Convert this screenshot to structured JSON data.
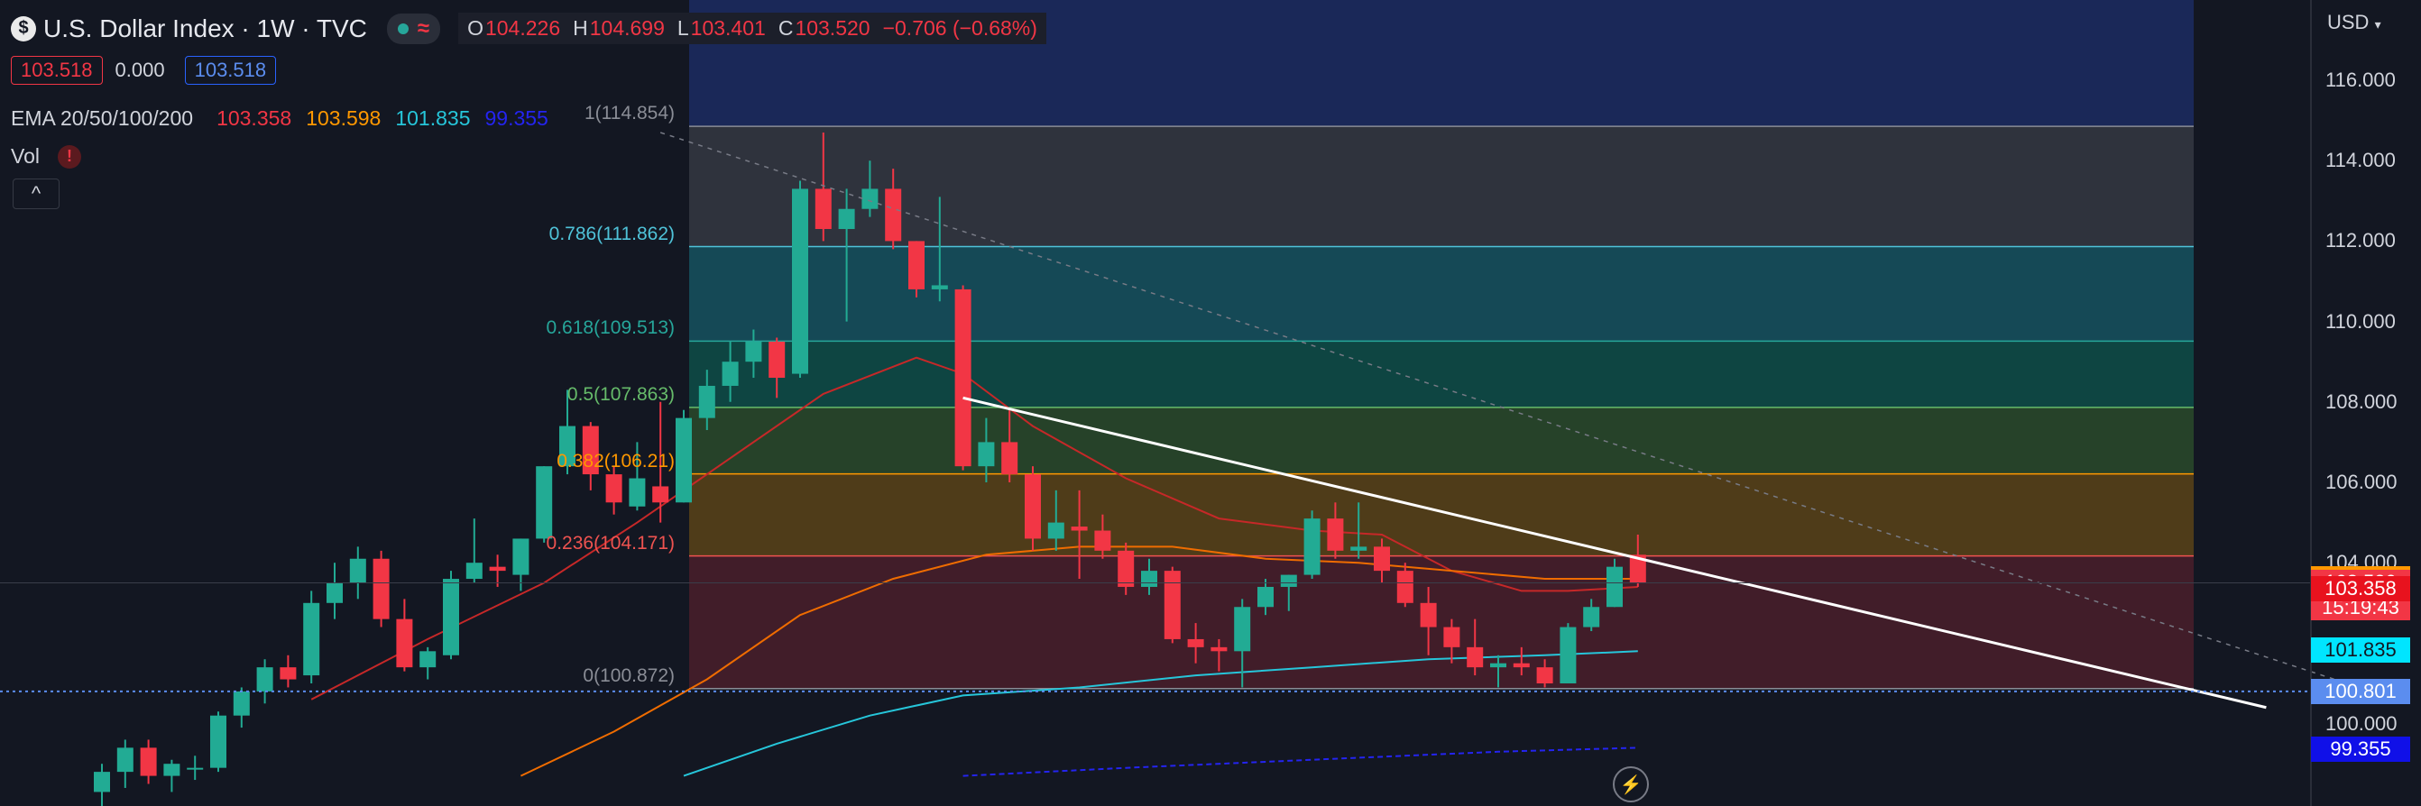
{
  "header": {
    "symbol_icon": "$",
    "title": "U.S. Dollar Index · 1W · TVC",
    "market_status_icon": "market-open-dot-icon",
    "wave_icon": "≈",
    "ohlc": {
      "o_label": "O",
      "o_value": "104.226",
      "h_label": "H",
      "h_value": "104.699",
      "l_label": "L",
      "l_value": "103.401",
      "c_label": "C",
      "c_value": "103.520",
      "change": "−0.706 (−0.68%)"
    }
  },
  "quote": {
    "sell": "103.518",
    "spread": "0.000",
    "buy": "103.518"
  },
  "indicators": {
    "ema_label": "EMA 20/50/100/200",
    "ema_values": [
      {
        "value": "103.358",
        "color": "#f23645"
      },
      {
        "value": "103.598",
        "color": "#ff9800"
      },
      {
        "value": "101.835",
        "color": "#26c6da"
      },
      {
        "value": "99.355",
        "color": "#2424f0"
      }
    ],
    "vol_label": "Vol",
    "vol_warning_icon": "!",
    "collapse_icon": "^"
  },
  "price_axis": {
    "currency": "USD",
    "ticks": [
      "116.000",
      "114.000",
      "112.000",
      "110.000",
      "108.000",
      "106.000",
      "104.000",
      "100.000"
    ],
    "tags": [
      {
        "text": "103.598",
        "bg": "#ff9800"
      },
      {
        "text": "103.520",
        "bg": "#f23645"
      },
      {
        "text": "15:19:43",
        "bg": "#f23645"
      },
      {
        "text": "103.358",
        "bg": "#e8121e"
      },
      {
        "text": "101.835",
        "bg": "#00e5ff"
      },
      {
        "text": "100.801",
        "bg": "#5b8def"
      },
      {
        "text": "99.355",
        "bg": "#1010e8"
      }
    ]
  },
  "fib": {
    "levels": [
      {
        "label": "1(114.854)",
        "color": "#8a8d96"
      },
      {
        "label": "0.786(111.862)",
        "color": "#4fc3d9"
      },
      {
        "label": "0.618(109.513)",
        "color": "#26a69a"
      },
      {
        "label": "0.5(107.863)",
        "color": "#66bb6a"
      },
      {
        "label": "0.382(106.21)",
        "color": "#ff9800"
      },
      {
        "label": "0.236(104.171)",
        "color": "#ef5350"
      },
      {
        "label": "0(100.872)",
        "color": "#8a8d96"
      }
    ]
  },
  "chart_data": {
    "type": "candlestick",
    "title": "U.S. Dollar Index · 1W · TVC",
    "ylabel": "USD",
    "ylim": [
      98.7,
      117.2
    ],
    "grid": false,
    "fib_retracement_values": [
      114.854,
      111.862,
      109.513,
      107.863,
      106.21,
      104.171,
      100.872
    ],
    "trendline": {
      "from": [
        37,
        108.1
      ],
      "to": [
        93,
        100.4
      ]
    },
    "dotted_line": {
      "from": [
        24,
        114.7
      ],
      "to": [
        97,
        100.9
      ]
    },
    "horizontal_price_line": 100.801,
    "candles": [
      {
        "o": 98.3,
        "h": 99.0,
        "l": 97.9,
        "c": 98.8
      },
      {
        "o": 98.8,
        "h": 99.6,
        "l": 98.4,
        "c": 99.4
      },
      {
        "o": 99.4,
        "h": 99.6,
        "l": 98.5,
        "c": 98.7
      },
      {
        "o": 98.7,
        "h": 99.1,
        "l": 98.3,
        "c": 99.0
      },
      {
        "o": 98.9,
        "h": 99.2,
        "l": 98.6,
        "c": 98.9
      },
      {
        "o": 98.9,
        "h": 100.3,
        "l": 98.8,
        "c": 100.2
      },
      {
        "o": 100.2,
        "h": 100.9,
        "l": 99.9,
        "c": 100.8
      },
      {
        "o": 100.8,
        "h": 101.6,
        "l": 100.5,
        "c": 101.4
      },
      {
        "o": 101.4,
        "h": 101.7,
        "l": 100.9,
        "c": 101.1
      },
      {
        "o": 101.2,
        "h": 103.3,
        "l": 101.0,
        "c": 103.0
      },
      {
        "o": 103.0,
        "h": 104.0,
        "l": 102.6,
        "c": 103.5
      },
      {
        "o": 103.5,
        "h": 104.4,
        "l": 103.1,
        "c": 104.1
      },
      {
        "o": 104.1,
        "h": 104.3,
        "l": 102.4,
        "c": 102.6
      },
      {
        "o": 102.6,
        "h": 103.1,
        "l": 101.3,
        "c": 101.4
      },
      {
        "o": 101.4,
        "h": 101.9,
        "l": 101.1,
        "c": 101.8
      },
      {
        "o": 101.7,
        "h": 103.8,
        "l": 101.6,
        "c": 103.6
      },
      {
        "o": 103.6,
        "h": 105.1,
        "l": 103.5,
        "c": 104.0
      },
      {
        "o": 103.9,
        "h": 104.2,
        "l": 103.4,
        "c": 103.8
      },
      {
        "o": 103.7,
        "h": 104.6,
        "l": 103.3,
        "c": 104.6
      },
      {
        "o": 104.6,
        "h": 106.4,
        "l": 104.5,
        "c": 106.4
      },
      {
        "o": 106.4,
        "h": 108.3,
        "l": 106.2,
        "c": 107.4
      },
      {
        "o": 107.4,
        "h": 107.5,
        "l": 105.8,
        "c": 106.2
      },
      {
        "o": 106.2,
        "h": 106.4,
        "l": 105.2,
        "c": 105.5
      },
      {
        "o": 105.4,
        "h": 107.0,
        "l": 105.3,
        "c": 106.1
      },
      {
        "o": 105.9,
        "h": 108.0,
        "l": 105.0,
        "c": 105.5
      },
      {
        "o": 105.5,
        "h": 107.8,
        "l": 105.5,
        "c": 107.6
      },
      {
        "o": 107.6,
        "h": 108.8,
        "l": 107.3,
        "c": 108.4
      },
      {
        "o": 108.4,
        "h": 109.5,
        "l": 108.0,
        "c": 109.0
      },
      {
        "o": 109.0,
        "h": 109.8,
        "l": 108.6,
        "c": 109.5
      },
      {
        "o": 109.5,
        "h": 109.6,
        "l": 108.1,
        "c": 108.6
      },
      {
        "o": 108.7,
        "h": 113.5,
        "l": 108.6,
        "c": 113.3
      },
      {
        "o": 113.3,
        "h": 114.7,
        "l": 112.0,
        "c": 112.3
      },
      {
        "o": 112.3,
        "h": 113.3,
        "l": 110.0,
        "c": 112.8
      },
      {
        "o": 112.8,
        "h": 114.0,
        "l": 112.6,
        "c": 113.3
      },
      {
        "o": 113.3,
        "h": 113.8,
        "l": 111.8,
        "c": 112.0
      },
      {
        "o": 112.0,
        "h": 112.0,
        "l": 110.6,
        "c": 110.8
      },
      {
        "o": 110.8,
        "h": 113.1,
        "l": 110.5,
        "c": 110.9
      },
      {
        "o": 110.8,
        "h": 110.9,
        "l": 106.3,
        "c": 106.4
      },
      {
        "o": 106.4,
        "h": 107.6,
        "l": 106.0,
        "c": 107.0
      },
      {
        "o": 107.0,
        "h": 107.8,
        "l": 106.0,
        "c": 106.2
      },
      {
        "o": 106.2,
        "h": 106.4,
        "l": 104.3,
        "c": 104.6
      },
      {
        "o": 104.6,
        "h": 105.8,
        "l": 104.3,
        "c": 105.0
      },
      {
        "o": 104.9,
        "h": 105.8,
        "l": 103.6,
        "c": 104.8
      },
      {
        "o": 104.8,
        "h": 105.2,
        "l": 104.1,
        "c": 104.3
      },
      {
        "o": 104.3,
        "h": 104.5,
        "l": 103.2,
        "c": 103.4
      },
      {
        "o": 103.4,
        "h": 104.1,
        "l": 103.2,
        "c": 103.8
      },
      {
        "o": 103.8,
        "h": 103.9,
        "l": 102.0,
        "c": 102.1
      },
      {
        "o": 102.1,
        "h": 102.5,
        "l": 101.5,
        "c": 101.9
      },
      {
        "o": 101.9,
        "h": 102.1,
        "l": 101.3,
        "c": 101.8
      },
      {
        "o": 101.8,
        "h": 103.1,
        "l": 100.9,
        "c": 102.9
      },
      {
        "o": 102.9,
        "h": 103.6,
        "l": 102.7,
        "c": 103.4
      },
      {
        "o": 103.4,
        "h": 103.7,
        "l": 102.8,
        "c": 103.7
      },
      {
        "o": 103.7,
        "h": 105.3,
        "l": 103.6,
        "c": 105.1
      },
      {
        "o": 105.1,
        "h": 105.5,
        "l": 104.1,
        "c": 104.3
      },
      {
        "o": 104.3,
        "h": 105.5,
        "l": 104.1,
        "c": 104.4
      },
      {
        "o": 104.4,
        "h": 104.6,
        "l": 103.5,
        "c": 103.8
      },
      {
        "o": 103.8,
        "h": 104.0,
        "l": 102.9,
        "c": 103.0
      },
      {
        "o": 103.0,
        "h": 103.4,
        "l": 101.7,
        "c": 102.4
      },
      {
        "o": 102.4,
        "h": 102.6,
        "l": 101.5,
        "c": 101.9
      },
      {
        "o": 101.9,
        "h": 102.6,
        "l": 101.2,
        "c": 101.4
      },
      {
        "o": 101.4,
        "h": 101.7,
        "l": 100.9,
        "c": 101.5
      },
      {
        "o": 101.5,
        "h": 101.9,
        "l": 101.2,
        "c": 101.4
      },
      {
        "o": 101.4,
        "h": 101.6,
        "l": 100.9,
        "c": 101.0
      },
      {
        "o": 101.0,
        "h": 102.5,
        "l": 101.0,
        "c": 102.4
      },
      {
        "o": 102.4,
        "h": 103.1,
        "l": 102.3,
        "c": 102.9
      },
      {
        "o": 102.9,
        "h": 104.1,
        "l": 102.9,
        "c": 103.9
      },
      {
        "o": 104.2,
        "h": 104.7,
        "l": 103.4,
        "c": 103.5
      }
    ],
    "ema_series": [
      {
        "name": "EMA 20",
        "color": "#c62828",
        "points": [
          [
            9,
            100.6
          ],
          [
            14,
            102.1
          ],
          [
            19,
            103.5
          ],
          [
            23,
            105.0
          ],
          [
            27,
            106.6
          ],
          [
            31,
            108.2
          ],
          [
            35,
            109.1
          ],
          [
            37,
            108.7
          ],
          [
            40,
            107.4
          ],
          [
            44,
            106.1
          ],
          [
            48,
            105.1
          ],
          [
            52,
            104.8
          ],
          [
            55,
            104.7
          ],
          [
            58,
            103.8
          ],
          [
            61,
            103.3
          ],
          [
            63,
            103.3
          ],
          [
            66,
            103.4
          ]
        ]
      },
      {
        "name": "EMA 50",
        "color": "#ef6c00",
        "points": [
          [
            18,
            98.7
          ],
          [
            22,
            99.8
          ],
          [
            26,
            101.1
          ],
          [
            30,
            102.7
          ],
          [
            34,
            103.6
          ],
          [
            38,
            104.2
          ],
          [
            42,
            104.4
          ],
          [
            46,
            104.4
          ],
          [
            50,
            104.1
          ],
          [
            54,
            104.0
          ],
          [
            58,
            103.8
          ],
          [
            62,
            103.6
          ],
          [
            66,
            103.6
          ]
        ]
      },
      {
        "name": "EMA 100",
        "color": "#26c6da",
        "points": [
          [
            25,
            98.7
          ],
          [
            29,
            99.5
          ],
          [
            33,
            100.2
          ],
          [
            37,
            100.7
          ],
          [
            42,
            100.9
          ],
          [
            47,
            101.2
          ],
          [
            52,
            101.4
          ],
          [
            57,
            101.6
          ],
          [
            62,
            101.7
          ],
          [
            66,
            101.8
          ]
        ]
      },
      {
        "name": "EMA 200",
        "color": "#2424f0",
        "points": [
          [
            37,
            98.7
          ],
          [
            44,
            98.9
          ],
          [
            52,
            99.1
          ],
          [
            60,
            99.3
          ],
          [
            66,
            99.4
          ]
        ]
      }
    ]
  }
}
